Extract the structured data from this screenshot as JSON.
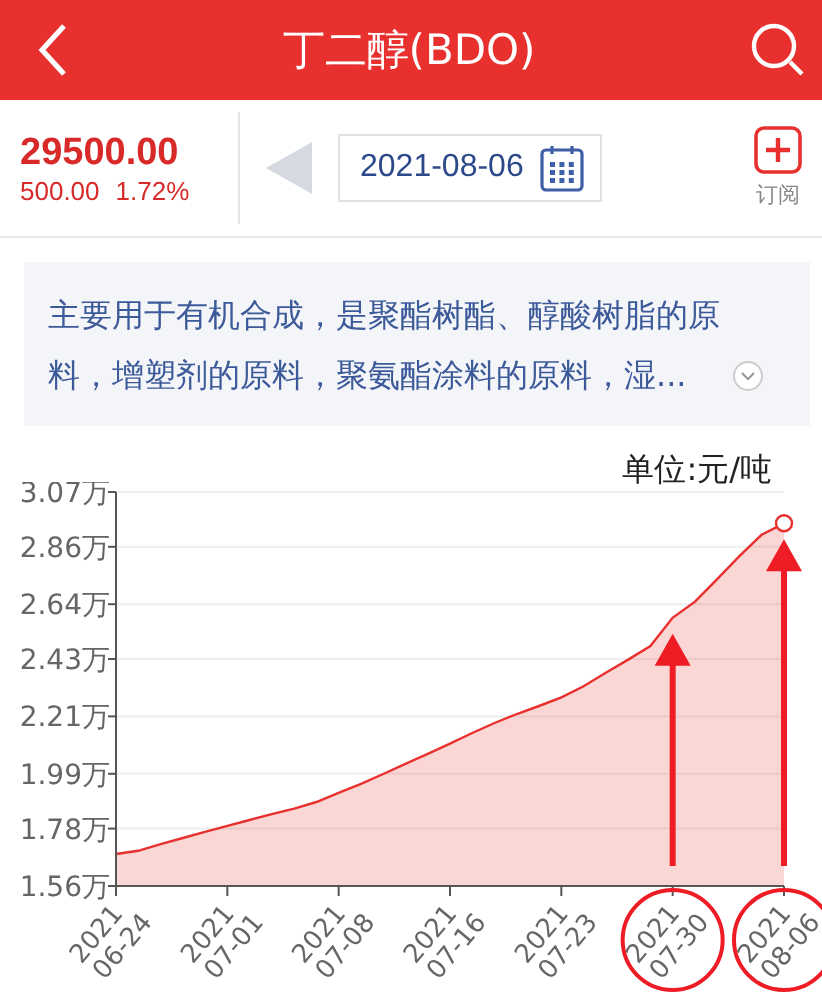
{
  "header": {
    "title": "丁二醇(BDO)"
  },
  "quote": {
    "price": "29500.00",
    "change": "500.00",
    "change_pct": "1.72%"
  },
  "date_picker": {
    "value": "2021-08-06"
  },
  "subscribe": {
    "label": "订阅"
  },
  "description": {
    "text": "主要用于有机合成，是聚酯树酯、醇酸树脂的原料，增塑剂的原料，聚氨酯涂料的原料，湿..."
  },
  "chart": {
    "unit": "单位:元/吨",
    "chart_data": {
      "type": "area",
      "categories": [
        "2021\n06-24",
        null,
        null,
        null,
        null,
        "2021\n07-01",
        null,
        null,
        null,
        null,
        "2021\n07-08",
        null,
        null,
        null,
        null,
        "2021\n07-16",
        null,
        null,
        null,
        null,
        "2021\n07-23",
        null,
        null,
        null,
        null,
        "2021\n07-30",
        null,
        null,
        null,
        null,
        "2021\n08-06"
      ],
      "series": [
        {
          "color": "#e8312f",
          "values": [
            1.683,
            1.695,
            1.72,
            1.744,
            1.768,
            1.791,
            1.813,
            1.835,
            1.857,
            1.882,
            1.917,
            1.952,
            1.989,
            2.028,
            2.067,
            2.106,
            2.146,
            2.185,
            2.219,
            2.25,
            2.283,
            2.326,
            2.377,
            2.428,
            2.48,
            2.588,
            2.65,
            2.736,
            2.824,
            2.907,
            2.95
          ]
        }
      ],
      "ylim": [
        1.56,
        3.07
      ],
      "grid": true,
      "yticks": [
        {
          "value": 1.56,
          "label": "1.56万"
        },
        {
          "value": 1.78,
          "label": "1.78万"
        },
        {
          "value": 1.99,
          "label": "1.99万"
        },
        {
          "value": 2.21,
          "label": "2.21万"
        },
        {
          "value": 2.43,
          "label": "2.43万"
        },
        {
          "value": 2.64,
          "label": "2.64万"
        },
        {
          "value": 2.86,
          "label": "2.86万"
        },
        {
          "value": 3.07,
          "label": "3.07万"
        }
      ]
    },
    "markup": [
      {
        "arrow": true,
        "circle": true
      },
      {
        "arrow": true,
        "circle": true
      }
    ]
  }
}
